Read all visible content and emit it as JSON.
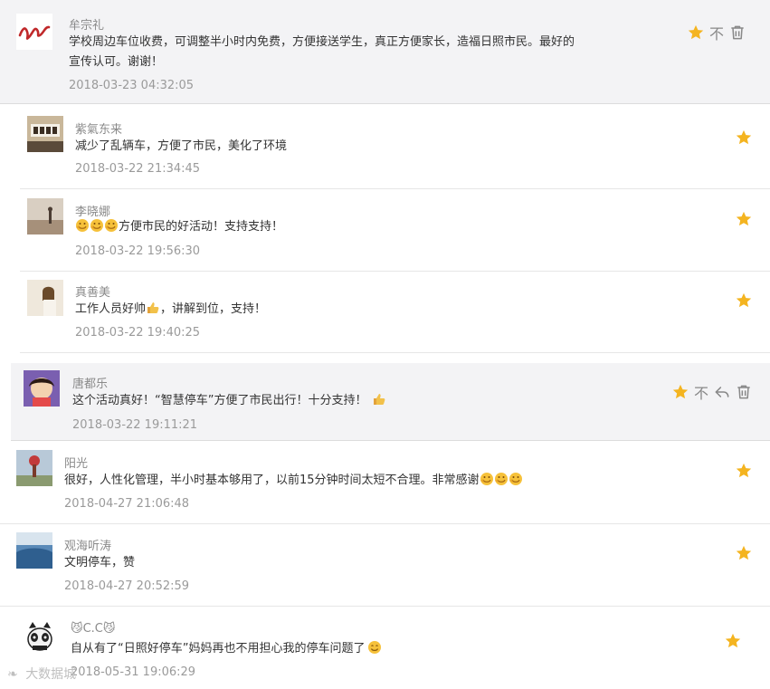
{
  "colors": {
    "star": "#f4b420",
    "highlight_bg": "#f3f3f5",
    "separator": "#e6e6e6",
    "action_gray": "#888888"
  },
  "comments": [
    {
      "user": "牟宗礼",
      "text_lines": [
        "学校周边车位收费，可调整半小时内免费，方便接送学生，真正方便家长，造福日照市民。最好的",
        "宣传认可。谢谢！"
      ],
      "time": "2018-03-23 04:32:05",
      "star_icon": "star-icon",
      "hide_label": "不",
      "delete_icon": "trash-icon"
    },
    {
      "user": "紫氣东来",
      "text": "减少了乱辆车，方便了市民，美化了环境",
      "time": "2018-03-22 21:34:45",
      "star_icon": "star-icon"
    },
    {
      "user": "李晓娜",
      "text": "方便市民的好活动！支持支持！",
      "time": "2018-03-22 19:56:30",
      "star_icon": "star-icon"
    },
    {
      "user": "真善美",
      "text_before": "工作人员好帅",
      "text_after": "，讲解到位，支持！",
      "time": "2018-03-22 19:40:25",
      "star_icon": "star-icon"
    },
    {
      "user": "唐都乐",
      "text": "这个活动真好！“智慧停车”方便了市民出行！十分支持！",
      "time": "2018-03-22 19:11:21",
      "star_icon": "star-icon",
      "hide_label": "不",
      "reply_icon": "reply-icon",
      "delete_icon": "trash-icon"
    },
    {
      "user": "阳光",
      "text": "很好，人性化管理，半小时基本够用了，以前15分钟时间太短不合理。非常感谢",
      "time": "2018-04-27 21:06:48",
      "star_icon": "star-icon"
    },
    {
      "user": "观海听涛",
      "text": "文明停车，赞",
      "time": "2018-04-27 20:52:59",
      "star_icon": "star-icon"
    },
    {
      "user": "C.C",
      "text": "自从有了“日照好停车”妈妈再也不用担心我的停车问题了",
      "time": "2018-05-31 19:06:29",
      "star_icon": "star-icon"
    }
  ],
  "watermark": "大数据城"
}
